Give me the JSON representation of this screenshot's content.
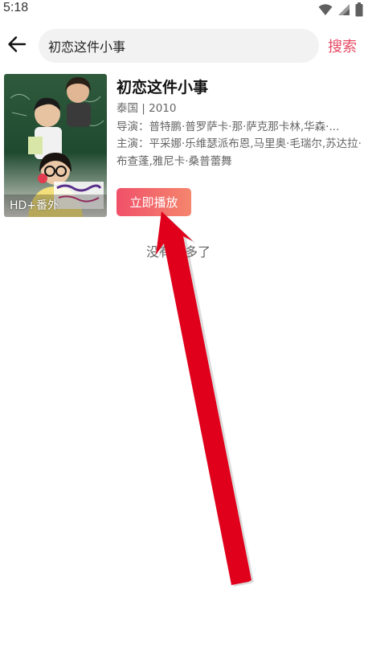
{
  "status_bar": {
    "time": "5:18",
    "icons": [
      "wifi-icon",
      "signal-icon",
      "battery-icon"
    ]
  },
  "search": {
    "query": "初恋这件小事",
    "search_label": "搜索"
  },
  "result": {
    "title": "初恋这件小事",
    "meta": "泰国 | 2010",
    "director": "导演：普特鹏·普罗萨卡·那·萨克那卡林,华森·...",
    "cast": "主演：平采娜·乐维瑟派布恩,马里奥·毛瑞尔,苏达拉·布查蓬,雅尼卡·桑普蕾舞",
    "badge": "HD+番外",
    "play_label": "立即播放"
  },
  "footer": {
    "no_more": "没有更多了"
  },
  "colors": {
    "accent": "#e64a63",
    "button_start": "#f0516a",
    "button_end": "#f5856d",
    "annotation_arrow": "#e0001b"
  }
}
